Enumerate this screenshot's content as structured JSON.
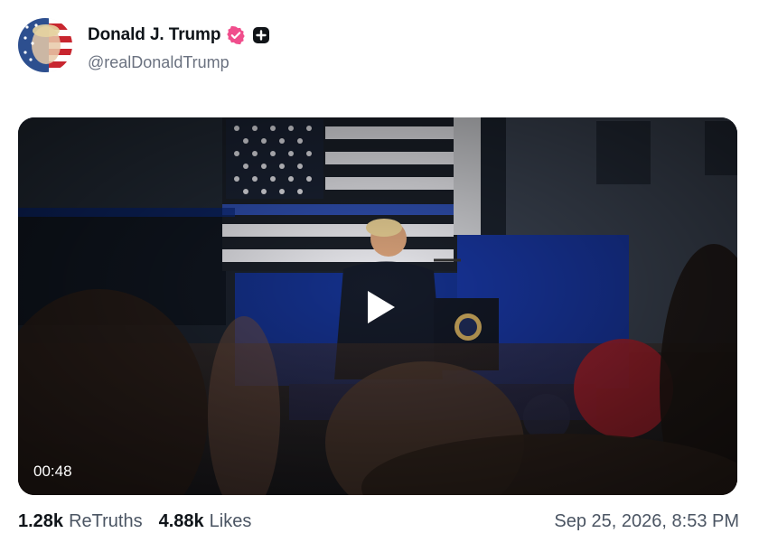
{
  "post": {
    "author": {
      "display_name": "Donald J. Trump",
      "handle": "@realDonaldTrump",
      "verified_icon": "verified-badge-icon",
      "extra_badge_icon": "plus-badge-icon"
    },
    "video": {
      "duration": "00:48",
      "play_icon": "play-icon"
    },
    "stats": {
      "retruths_count": "1.28k",
      "retruths_label": "ReTruths",
      "likes_count": "4.88k",
      "likes_label": "Likes"
    },
    "timestamp": "Sep 25, 2026, 8:53 PM"
  },
  "colors": {
    "verified": "#f04e8c",
    "text_primary": "#0f1419",
    "text_secondary": "#6b7280"
  }
}
